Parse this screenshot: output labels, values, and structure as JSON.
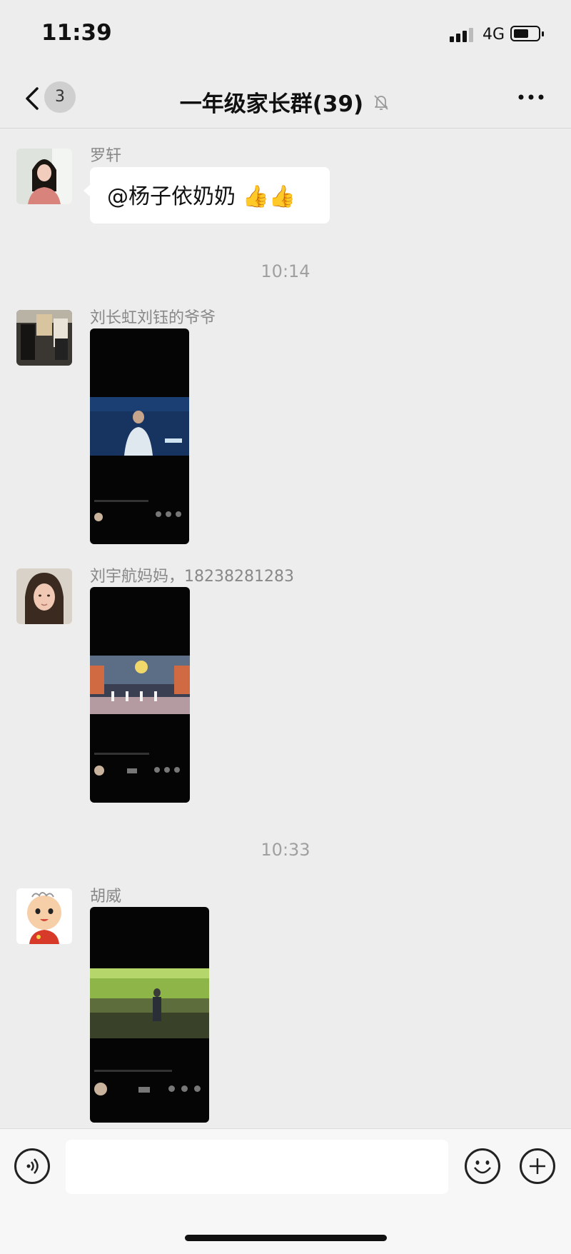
{
  "status_bar": {
    "time": "11:39",
    "network": "4G",
    "icons": [
      "signal-icon",
      "battery-icon"
    ]
  },
  "nav": {
    "back_icon": "chevron-left-icon",
    "unread_count": "3",
    "title": "一年级家长群(39)",
    "mute_icon": "bell-off-icon",
    "more_icon": "more-horizontal-icon"
  },
  "messages": [
    {
      "type": "text",
      "sender": "罗轩",
      "text": "@杨子依奶奶 👍👍"
    },
    {
      "type": "timestamp",
      "text": "10:14"
    },
    {
      "type": "video",
      "sender": "刘长虹刘钰的爷爷"
    },
    {
      "type": "video",
      "sender": "刘宇航妈妈，18238281283"
    },
    {
      "type": "timestamp",
      "text": "10:33"
    },
    {
      "type": "video",
      "sender": "胡威"
    }
  ],
  "input_bar": {
    "voice_icon": "voice-icon",
    "emoji_icon": "emoji-icon",
    "plus_icon": "plus-icon",
    "input_value": ""
  },
  "colors": {
    "background": "#ededed",
    "bubble": "#ffffff",
    "video": "#050505"
  }
}
